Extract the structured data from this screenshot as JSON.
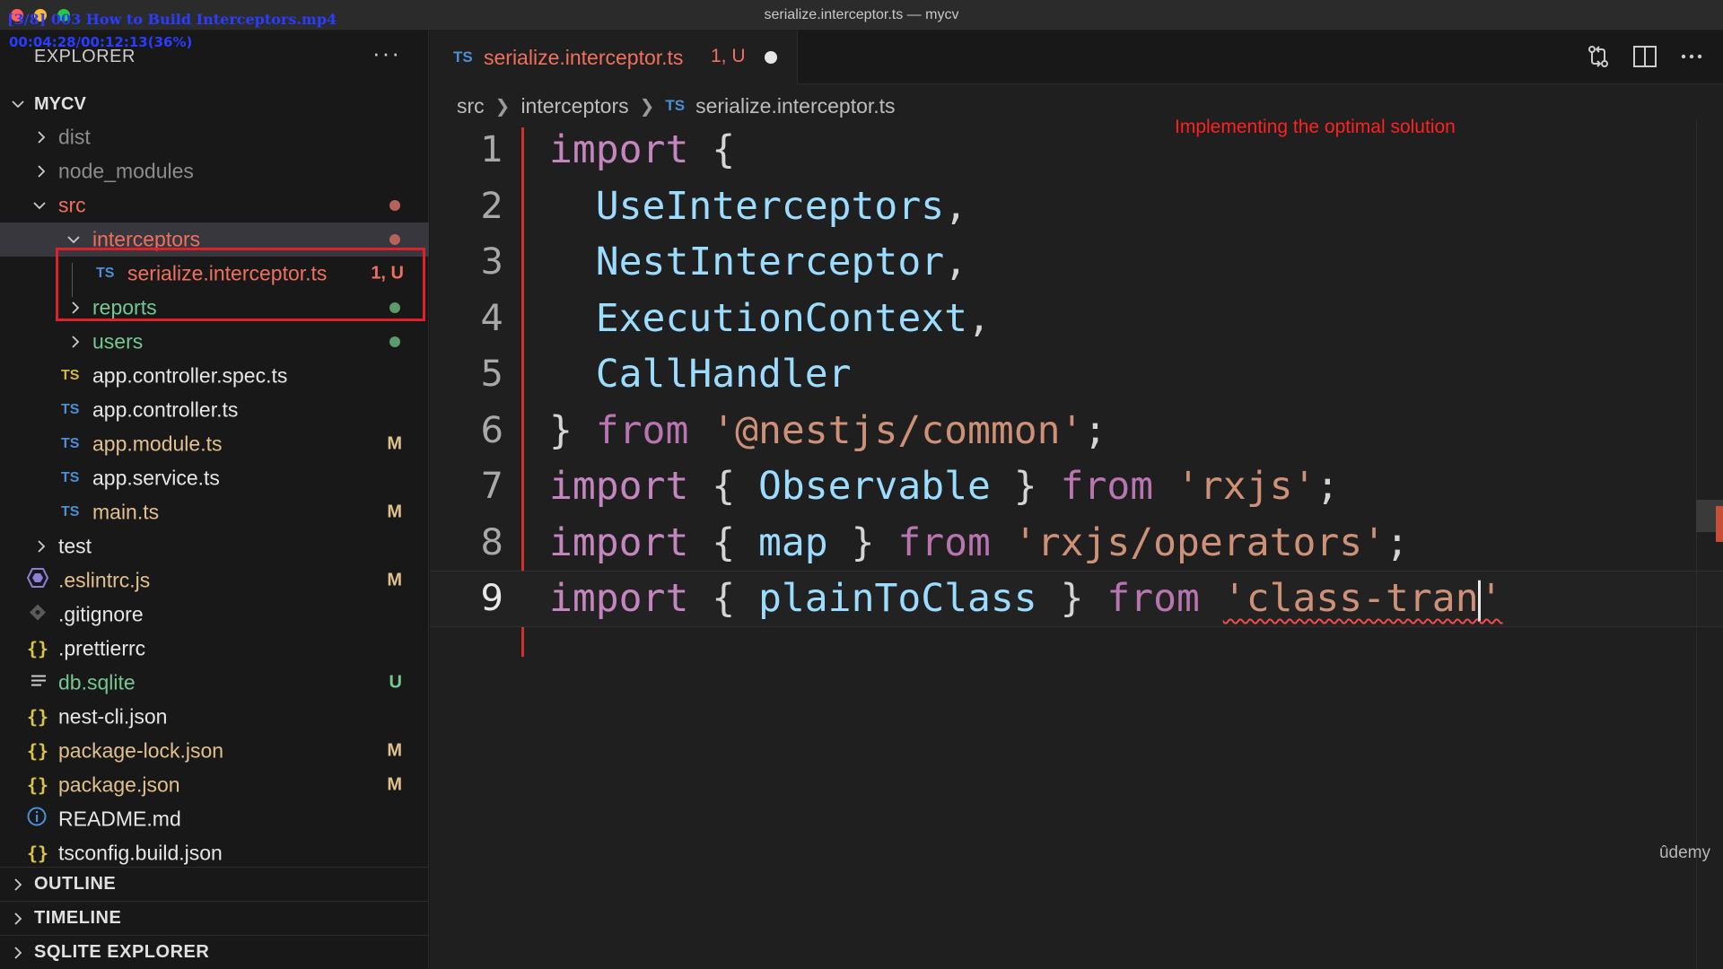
{
  "window": {
    "title": "serialize.interceptor.ts — mycv",
    "video_overlay": "[3/8] 003 How to Build Interceptors.mp4",
    "time_overlay": "00:04:28/00:12:13(36%)"
  },
  "sidebar": {
    "header": "EXPLORER",
    "more": "···",
    "root": "MYCV",
    "items": [
      {
        "name": "dist",
        "type": "folder",
        "expanded": false,
        "color": "#8c8c8c"
      },
      {
        "name": "node_modules",
        "type": "folder",
        "expanded": false,
        "color": "#8c8c8c"
      },
      {
        "name": "src",
        "type": "folder",
        "expanded": true,
        "color": "#f0705f",
        "dot": "#b5625a"
      },
      {
        "name": "interceptors",
        "type": "folder",
        "expanded": true,
        "color": "#f0705f",
        "dot": "#b5625a"
      },
      {
        "name": "serialize.interceptor.ts",
        "icon": "TS",
        "badge": "1, U",
        "color": "#f0705f"
      },
      {
        "name": "reports",
        "type": "folder",
        "expanded": false,
        "color": "#73c991",
        "dot": "#5a9a6b"
      },
      {
        "name": "users",
        "type": "folder",
        "expanded": false,
        "color": "#73c991",
        "dot": "#5a9a6b"
      },
      {
        "name": "app.controller.spec.ts",
        "icon": "TS"
      },
      {
        "name": "app.controller.ts",
        "icon": "TS"
      },
      {
        "name": "app.module.ts",
        "icon": "TS",
        "badge": "M"
      },
      {
        "name": "app.service.ts",
        "icon": "TS"
      },
      {
        "name": "main.ts",
        "icon": "TS",
        "badge": "M"
      },
      {
        "name": "test",
        "type": "folder",
        "expanded": false
      },
      {
        "name": ".eslintrc.js",
        "badge": "M"
      },
      {
        "name": ".gitignore"
      },
      {
        "name": ".prettierrc",
        "icon": "{}"
      },
      {
        "name": "db.sqlite",
        "badge": "U"
      },
      {
        "name": "nest-cli.json",
        "icon": "{}"
      },
      {
        "name": "package-lock.json",
        "icon": "{}",
        "badge": "M"
      },
      {
        "name": "package.json",
        "icon": "{}",
        "badge": "M"
      },
      {
        "name": "README.md"
      },
      {
        "name": "tsconfig.build.json",
        "icon": "{}"
      }
    ],
    "panels": [
      "OUTLINE",
      "TIMELINE",
      "SQLITE EXPLORER"
    ]
  },
  "editor": {
    "tab": {
      "icon": "TS",
      "name": "serialize.interceptor.ts",
      "badge": "1, U"
    },
    "breadcrumb": [
      "src",
      "interceptors",
      "serialize.interceptor.ts"
    ],
    "breadcrumb_icon": "TS",
    "annotation": "Implementing the optimal solution",
    "watermark": "ûdemy",
    "line_numbers": [
      "1",
      "2",
      "3",
      "4",
      "5",
      "6",
      "7",
      "8",
      "9"
    ],
    "code": {
      "l1": {
        "kw": "import",
        "p": " {"
      },
      "l2": {
        "id": "  UseInterceptors",
        "p": ","
      },
      "l3": {
        "id": "  NestInterceptor",
        "p": ","
      },
      "l4": {
        "id": "  ExecutionContext",
        "p": ","
      },
      "l5": {
        "id": "  CallHandler"
      },
      "l6": {
        "p1": "} ",
        "kw": "from",
        "st": " '@nestjs/common'",
        "p2": ";"
      },
      "l7": {
        "kw1": "import",
        "p1": " { ",
        "id": "Observable",
        "p2": " } ",
        "kw2": "from",
        "st": " 'rxjs'",
        "p3": ";"
      },
      "l8": {
        "kw1": "import",
        "p1": " { ",
        "id": "map",
        "p2": " } ",
        "kw2": "from",
        "st": " 'rxjs/operators'",
        "p3": ";"
      },
      "l9": {
        "kw1": "import",
        "p1": " { ",
        "id": "plainToClass",
        "p2": " } ",
        "kw2": "from",
        "sp": " ",
        "st1": "'class-tran",
        "st2": "'"
      }
    }
  },
  "colors": {
    "accent_red": "#e0202a",
    "modified": "#e2c08d",
    "untracked": "#73c991",
    "error": "#f0705f"
  }
}
